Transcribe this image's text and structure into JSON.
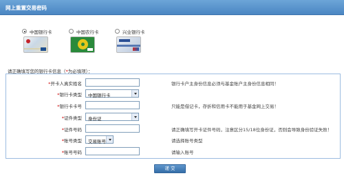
{
  "header": {
    "title": "网上重置交易密码"
  },
  "banks": [
    {
      "name": "中国银行卡",
      "selected": true,
      "card_icon": "boc-card-icon"
    },
    {
      "name": "中国农行卡",
      "selected": false,
      "card_icon": "abc-card-icon"
    },
    {
      "name": "兴业银行卡",
      "selected": false,
      "card_icon": "cib-card-icon"
    }
  ],
  "intro": {
    "text": "请正确填写您的银行卡信息（",
    "required_mark": "*",
    "required_text": "为必填项",
    "close": "）："
  },
  "form": {
    "rows": [
      {
        "star": "*",
        "label": "开卡人真实姓名",
        "type": "text",
        "value": "",
        "hint": "银行卡户主身份信息必须与基金账户主身份信息相同！"
      },
      {
        "star": "*",
        "label": "银行卡类型",
        "type": "select",
        "value": "中国银行卡",
        "hint": ""
      },
      {
        "star": "*",
        "label": "银行卡卡号",
        "type": "text",
        "value": "",
        "hint": "只能是借记卡，存折和信用卡不能用于基金网上交易！"
      },
      {
        "star": "*",
        "label": "证件类型",
        "type": "select",
        "value": "身份证",
        "hint": ""
      },
      {
        "star": "*",
        "label": "证件号码",
        "type": "text",
        "value": "",
        "hint": "请正确填写开卡证件号码，注意区分15/18位身份证，否则会导致身份验证失败！"
      },
      {
        "star": "*",
        "label": "账号类型",
        "type": "select-small",
        "value": "交易账号",
        "hint": "请选择账号类型"
      },
      {
        "star": "*",
        "label": "账号号码",
        "type": "text",
        "value": "",
        "hint": "请输入账号"
      }
    ]
  },
  "submit": {
    "label": "递 交"
  },
  "colors": {
    "header": "#4b86c2",
    "required": "#cc0000",
    "border": "#9bbbe0"
  }
}
